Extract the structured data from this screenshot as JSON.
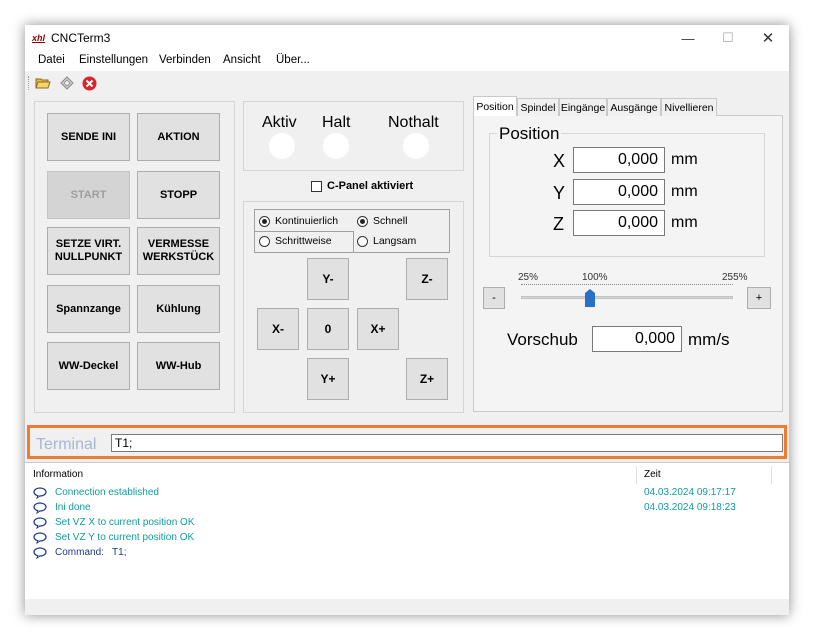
{
  "window": {
    "title": "CNCTerm3",
    "icon_text": "xhl",
    "minimize": "—",
    "maximize": "☐",
    "close": "✕"
  },
  "menu": [
    "Datei",
    "Einstellungen",
    "Verbinden",
    "Ansicht",
    "Über..."
  ],
  "toolbar": [
    {
      "icon": "open-folder-icon"
    },
    {
      "icon": "diamond-icon"
    },
    {
      "icon": "stop-red-icon"
    }
  ],
  "left_buttons": {
    "send_ini": "SENDE INI",
    "aktion": "AKTION",
    "start": "START",
    "stopp": "STOPP",
    "setze_virt_1": "SETZE VIRT.",
    "setze_virt_2": "NULLPUNKT",
    "vermesse_1": "VERMESSE",
    "vermesse_2": "WERKSTÜCK",
    "spannzange": "Spannzange",
    "kuehlung": "Kühlung",
    "ww_deckel": "WW-Deckel",
    "ww_hub": "WW-Hub"
  },
  "status": {
    "aktiv": "Aktiv",
    "halt": "Halt",
    "nothalt": "Nothalt"
  },
  "cpanel": {
    "label": "C-Panel aktiviert",
    "checked": false
  },
  "jog_mode": {
    "kontinuierlich": "Kontinuierlich",
    "schrittweise": "Schrittweise",
    "schnell": "Schnell",
    "langsam": "Langsam"
  },
  "jog": {
    "y_minus": "Y-",
    "y_plus": "Y+",
    "x_minus": "X-",
    "x_plus": "X+",
    "zero": "0",
    "z_minus": "Z-",
    "z_plus": "Z+"
  },
  "tabs": [
    "Position",
    "Spindel",
    "Eingänge",
    "Ausgänge",
    "Nivellieren"
  ],
  "position": {
    "title": "Position",
    "unit": "mm",
    "axes": [
      {
        "name": "X",
        "value": "0,000"
      },
      {
        "name": "Y",
        "value": "0,000"
      },
      {
        "name": "Z",
        "value": "0,000"
      }
    ]
  },
  "override": {
    "min_label": "25%",
    "mid_label": "100%",
    "max_label": "255%",
    "minus": "-",
    "plus": "+",
    "value_percent": 100
  },
  "vorschub": {
    "label": "Vorschub",
    "value": "0,000",
    "unit": "mm/s"
  },
  "terminal": {
    "label": "Terminal",
    "value": "T1;"
  },
  "log": {
    "col_info": "Information",
    "col_time": "Zeit",
    "rows": [
      {
        "text": "Connection established",
        "time": "04.03.2024 09:17:17"
      },
      {
        "text": "Ini done",
        "time": "04.03.2024 09:18:23"
      },
      {
        "text": "Set VZ X to current position OK",
        "time": ""
      },
      {
        "text": "Set VZ Y to current position OK",
        "time": ""
      },
      {
        "text": "Command:   T1;",
        "time": ""
      }
    ]
  },
  "colors": {
    "accent": "#ed7d31",
    "slider": "#2a6fc9",
    "log_text": "#0f9d9d",
    "log_cmd": "#1f3a8a"
  }
}
